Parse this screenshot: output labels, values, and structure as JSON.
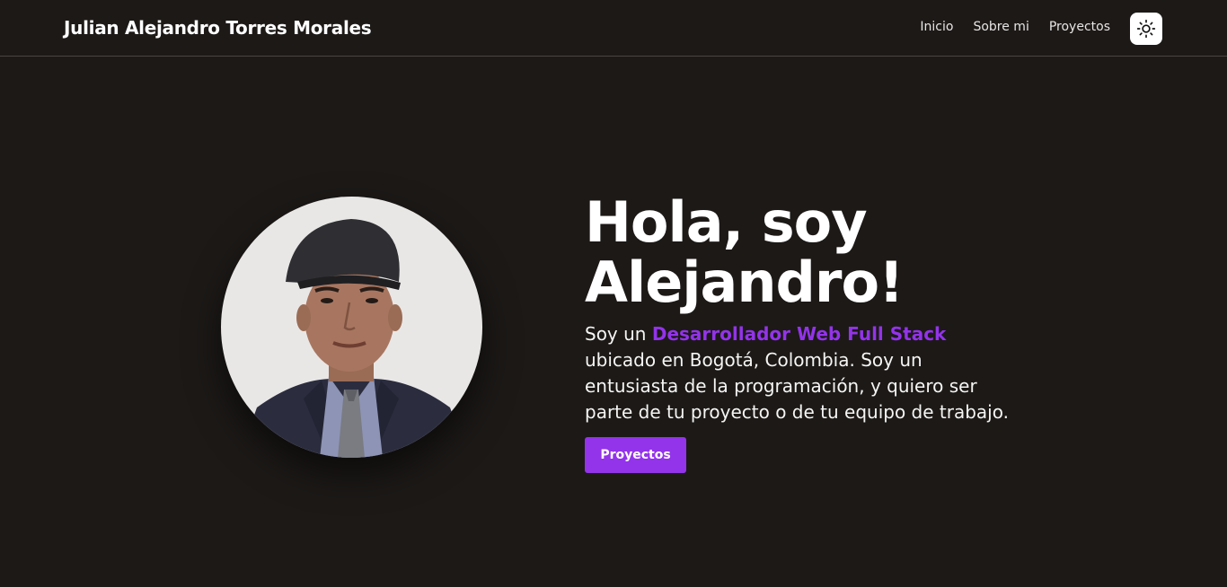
{
  "header": {
    "brand": "Julian Alejandro Torres Morales",
    "nav": [
      "Inicio",
      "Sobre mi",
      "Proyectos"
    ],
    "theme_toggle_icon": "sun-icon"
  },
  "hero": {
    "title_line1": "Hola, soy",
    "title_line2": "Alejandro!",
    "desc_prefix": "Soy un ",
    "desc_highlight": "Desarrollador Web Full Stack",
    "desc_rest": " ubicado en Bogotá, Colombia. Soy un entusiasta de la programación, y quiero ser parte de tu proyecto o de tu equipo de trabajo.",
    "cta_label": "Proyectos",
    "photo_icon": "profile-photo"
  },
  "colors": {
    "background": "#1c1917",
    "accent": "#9333ea",
    "text": "#ffffff"
  }
}
